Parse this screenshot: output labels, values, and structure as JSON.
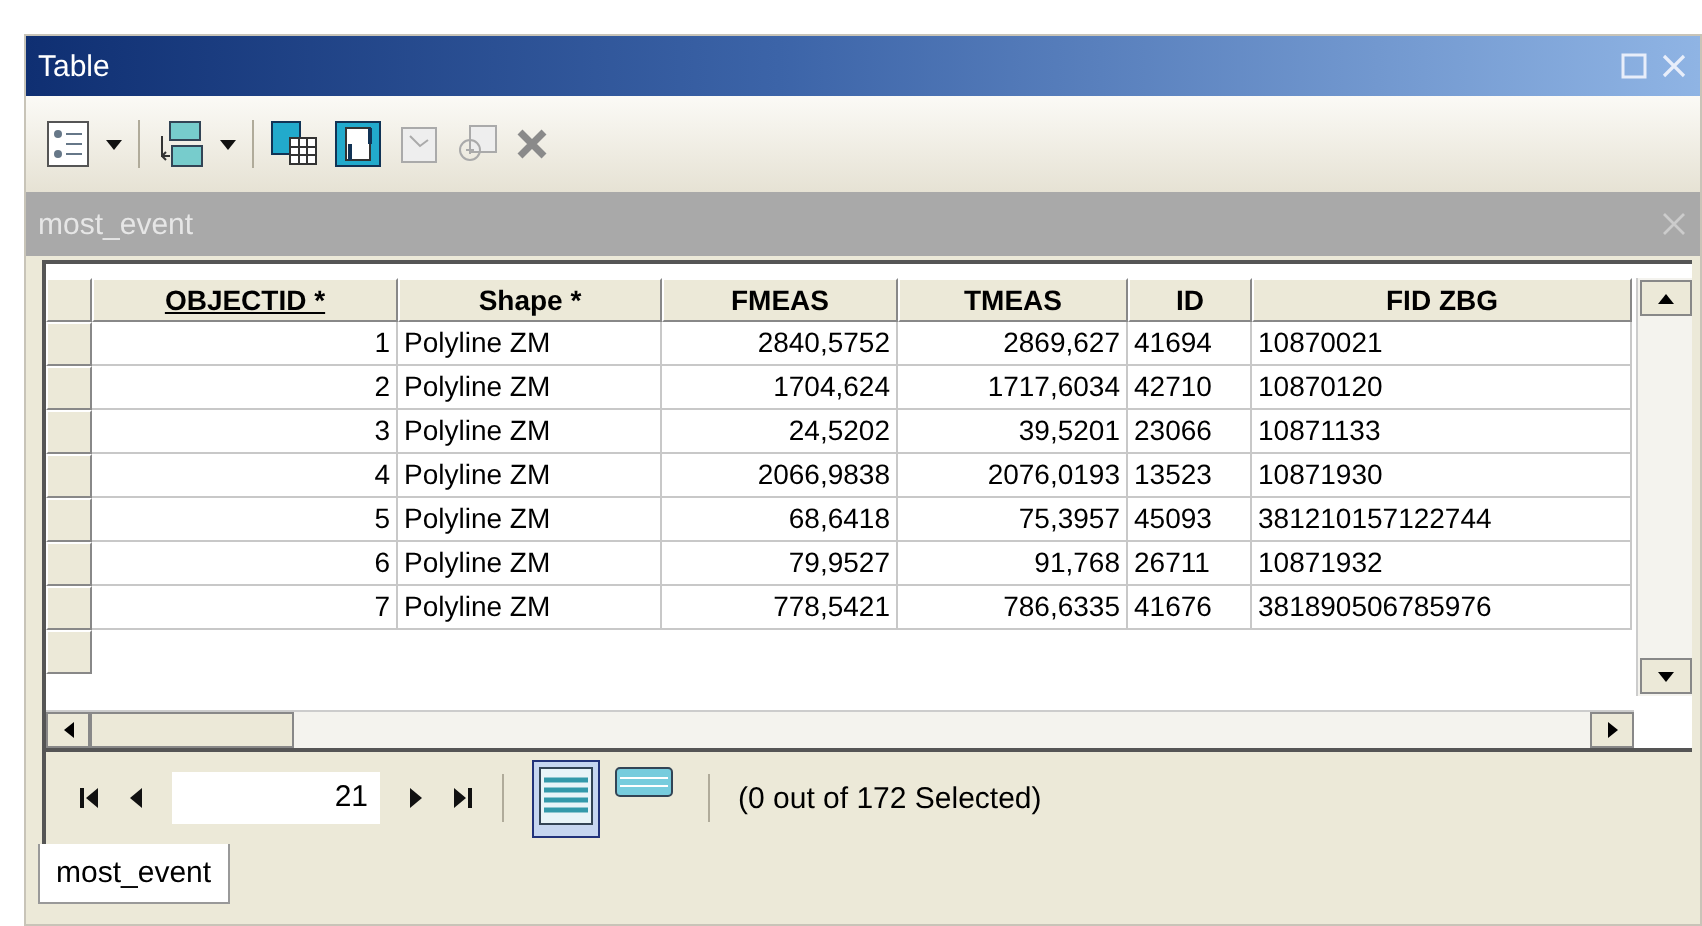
{
  "window": {
    "title": "Table"
  },
  "layer_title": "most_event",
  "table": {
    "columns": [
      "OBJECTID *",
      "Shape *",
      "FMEAS",
      "TMEAS",
      "ID",
      "FID ZBG"
    ],
    "rows": [
      [
        "1",
        "Polyline ZM",
        "2840,5752",
        "2869,627",
        "41694",
        "10870021"
      ],
      [
        "2",
        "Polyline ZM",
        "1704,624",
        "1717,6034",
        "42710",
        "10870120"
      ],
      [
        "3",
        "Polyline ZM",
        "24,5202",
        "39,5201",
        "23066",
        "10871133"
      ],
      [
        "4",
        "Polyline ZM",
        "2066,9838",
        "2076,0193",
        "13523",
        "10871930"
      ],
      [
        "5",
        "Polyline ZM",
        "68,6418",
        "75,3957",
        "45093",
        "381210157122744"
      ],
      [
        "6",
        "Polyline ZM",
        "79,9527",
        "91,768",
        "26711",
        "10871932"
      ],
      [
        "7",
        "Polyline ZM",
        "778,5421",
        "786,6335",
        "41676",
        "381890506785976"
      ]
    ]
  },
  "navigator": {
    "record": "21",
    "views": [
      {
        "kind": "all",
        "selected": true
      },
      {
        "kind": "selected",
        "selected": false
      }
    ],
    "status": "(0 out of 172 Selected)"
  },
  "tabs": [
    {
      "label": "most_event",
      "selected": true
    }
  ]
}
